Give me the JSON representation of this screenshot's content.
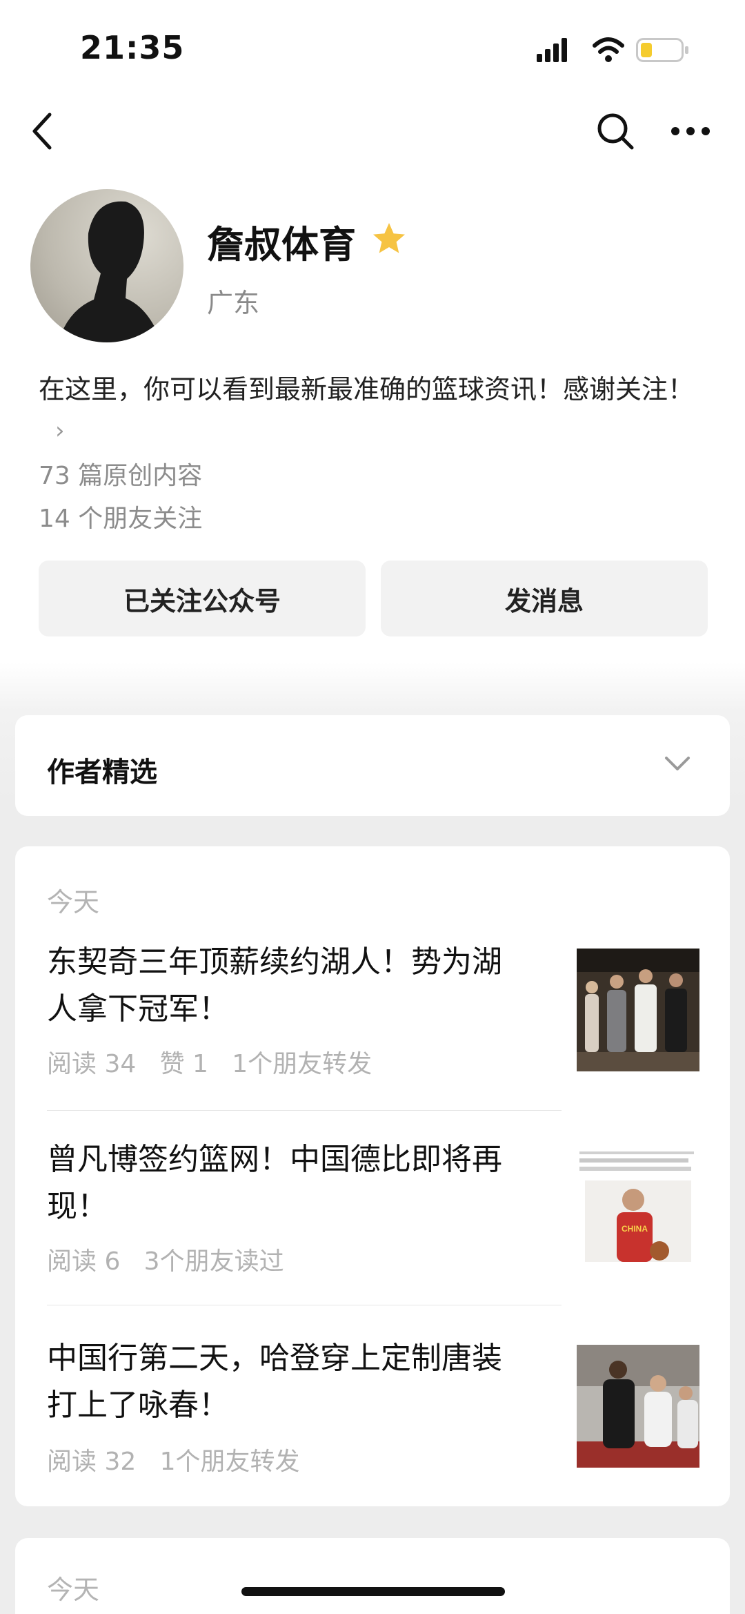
{
  "status_bar": {
    "time": "21:35"
  },
  "nav": {
    "back_icon": "chevron-left-icon",
    "search_icon": "search-icon",
    "more_icon": "more-dots-icon"
  },
  "profile": {
    "name": "詹叔体育",
    "region": "广东",
    "star_color": "#F6C343",
    "bio": "在这里，你可以看到最新最准确的篮球资讯！感谢关注！",
    "bio_arrow": "›",
    "original_count": "73 篇原创内容",
    "friends_following": "14 个朋友关注"
  },
  "actions": {
    "follow_label": "已关注公众号",
    "message_label": "发消息"
  },
  "featured": {
    "title": "作者精选"
  },
  "articles_section": {
    "date_label": "今天",
    "items": [
      {
        "title_line1": "东契奇三年顶薪续约湖人！势为湖",
        "title_line2": "人拿下冠军！",
        "meta": "阅读 34   赞 1   1个朋友转发"
      },
      {
        "title_line1": "曾凡博签约篮网！中国德比即将再",
        "title_line2": "现！",
        "meta": "阅读 6   3个朋友读过",
        "thumb_text": "CHINA"
      },
      {
        "title_line1": "中国行第二天，哈登穿上定制唐装",
        "title_line2": "打上了咏春！",
        "meta": "阅读 32   1个朋友转发"
      }
    ]
  },
  "next_section": {
    "date_label": "今天"
  },
  "colors": {
    "background": "#EDEDED",
    "card": "#FFFFFF",
    "button": "#F2F2F2",
    "meta_text": "#B2B2B2"
  }
}
